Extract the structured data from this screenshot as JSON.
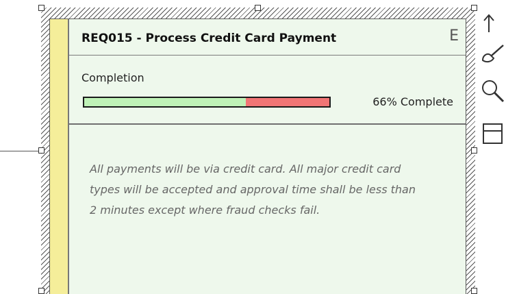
{
  "element": {
    "title": "REQ015 - Process Credit Card Payment",
    "type_glyph": "E",
    "completion_label": "Completion",
    "progress": {
      "percent": 66,
      "text": "66% Complete"
    },
    "notes": "All payments will be via credit card. All major credit card types will be accepted and approval time shall be less than 2 minutes except where fraud checks fail."
  },
  "colors": {
    "card_background": "#eef8ec",
    "yellow_bar": "#f5ee9a",
    "progress_complete": "#bff2b7",
    "progress_remaining": "#f17575"
  },
  "toolbar": {
    "icons": [
      "arrow-up-icon",
      "brush-icon",
      "magnifier-icon",
      "panel-icon"
    ]
  }
}
